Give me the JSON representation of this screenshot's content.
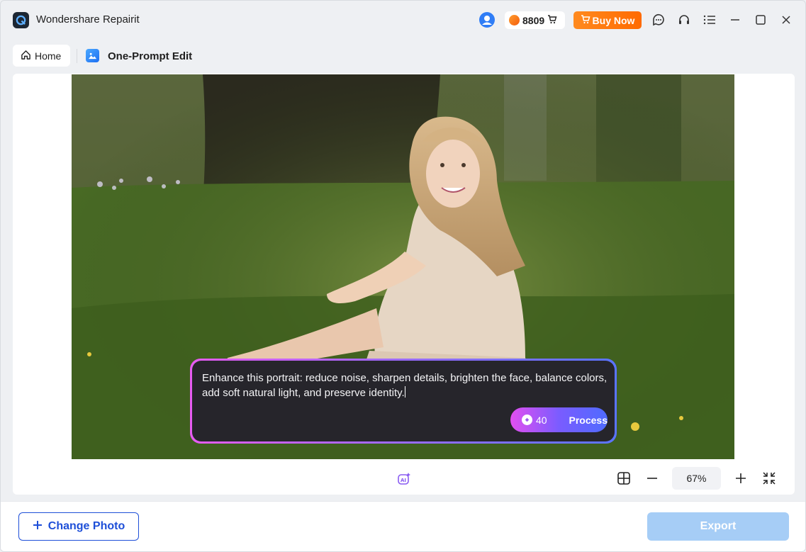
{
  "app": {
    "title": "Wondershare Repairit",
    "logo_icon": "repairit-logo-icon"
  },
  "titlebar": {
    "credits": "8809",
    "buy_now_label": "Buy Now",
    "icons": [
      "user-avatar-icon",
      "coin-icon",
      "cart-icon",
      "chat-icon",
      "headset-icon",
      "menu-icon",
      "minimize-icon",
      "maximize-icon",
      "close-icon"
    ]
  },
  "breadcrumb": {
    "home_label": "Home",
    "current_label": "One-Prompt Edit"
  },
  "prompt": {
    "text": "Enhance this portrait: reduce noise, sharpen details, brighten the face, balance colors, add soft natural light, and preserve identity.",
    "cost": "40",
    "process_label": "Process"
  },
  "toolbar": {
    "zoom_level": "67%"
  },
  "footer": {
    "change_photo_label": "Change Photo",
    "export_label": "Export"
  },
  "colors": {
    "accent": "#1e4fd8",
    "buy_orange": "#ff7a10",
    "export_disabled": "#a6cdf6",
    "process_gradient_start": "#e24ff0",
    "process_gradient_end": "#4f6bff"
  }
}
